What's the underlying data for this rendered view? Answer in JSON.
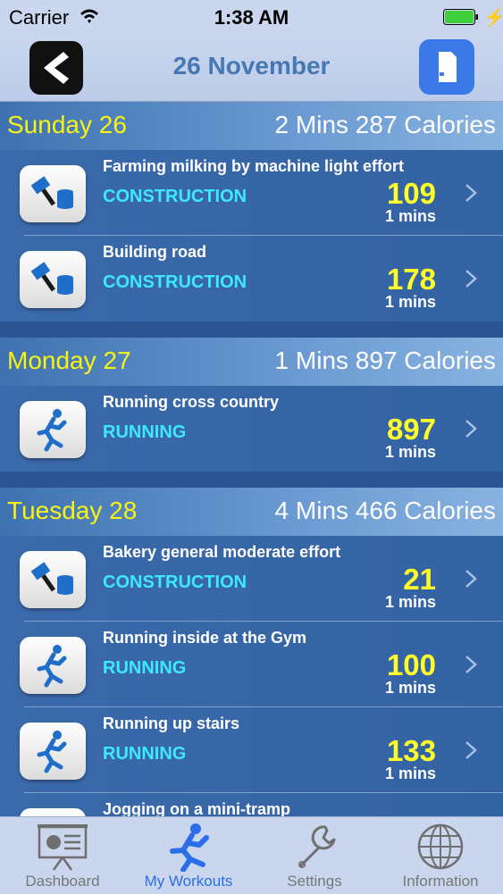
{
  "status_bar": {
    "carrier": "Carrier",
    "time": "1:38 AM"
  },
  "nav": {
    "title": "26 November",
    "back_icon": "back-arrow-icon",
    "doc_icon": "document-icon"
  },
  "days": [
    {
      "day": "Sunday 26",
      "summary": "2 Mins 287 Calories",
      "workouts": [
        {
          "title": "Farming milking by machine light effort",
          "category": "CONSTRUCTION",
          "calories": "109",
          "mins": "1 mins",
          "icon": "construction-icon"
        },
        {
          "title": "Building road",
          "category": "CONSTRUCTION",
          "calories": "178",
          "mins": "1 mins",
          "icon": "construction-icon"
        }
      ]
    },
    {
      "day": "Monday 27",
      "summary": "1 Mins 897 Calories",
      "workouts": [
        {
          "title": "Running cross country",
          "category": "RUNNING",
          "calories": "897",
          "mins": "1 mins",
          "icon": "runner-icon"
        }
      ]
    },
    {
      "day": "Tuesday 28",
      "summary": "4 Mins 466 Calories",
      "workouts": [
        {
          "title": "Bakery general moderate effort",
          "category": "CONSTRUCTION",
          "calories": "21",
          "mins": "1 mins",
          "icon": "construction-icon"
        },
        {
          "title": "Running inside at the Gym",
          "category": "RUNNING",
          "calories": "100",
          "mins": "1 mins",
          "icon": "runner-icon"
        },
        {
          "title": "Running up stairs",
          "category": "RUNNING",
          "calories": "133",
          "mins": "1 mins",
          "icon": "runner-icon"
        },
        {
          "title": "Jogging on a mini-tramp",
          "category": "",
          "calories": "",
          "mins": "",
          "icon": "runner-icon"
        }
      ]
    }
  ],
  "tabs": [
    {
      "label": "Dashboard",
      "icon": "presentation-board-icon",
      "active": false
    },
    {
      "label": "My Workouts",
      "icon": "runner-icon",
      "active": true
    },
    {
      "label": "Settings",
      "icon": "wrench-icon",
      "active": false
    },
    {
      "label": "Information",
      "icon": "globe-icon",
      "active": false
    }
  ],
  "colors": {
    "day_label": "#f6f315",
    "category": "#3ee8ff",
    "calories": "#ffff2a",
    "active_tab": "#2a6fe8",
    "nav_title": "#4678b4"
  }
}
